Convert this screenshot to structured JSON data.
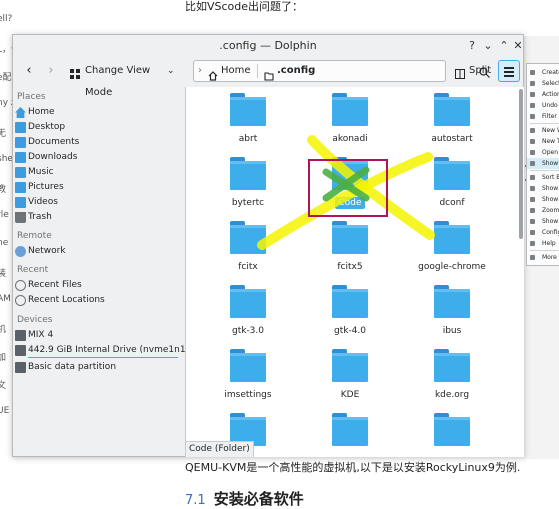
{
  "background": {
    "top_text": "比如VScode出问题了：",
    "left_fragments": [
      "ell?",
      "L，优",
      "e配",
      "ny z",
      "无",
      "she",
      "教",
      "rle",
      "ne",
      "装",
      "AM",
      "机",
      "加",
      "文",
      "UE"
    ],
    "bottom_text": "QEMU-KVM是一个高性能的虚拟机,以下是以安装RockyLinux9为例.",
    "heading_number": "7.1",
    "heading_text": "安装必备软件"
  },
  "window": {
    "title": ".config — Dolphin",
    "buttons": {
      "help": "?",
      "minimize": "⌄",
      "maximize": "⌃",
      "close": "✕"
    }
  },
  "toolbar": {
    "back": "‹",
    "forward": "›",
    "change_view_mode": "Change View Mode",
    "home_crumb": "Home",
    "current_crumb": ".config",
    "split": "Split"
  },
  "sidebar": {
    "places_header": "Places",
    "places": [
      "Home",
      "Desktop",
      "Documents",
      "Downloads",
      "Music",
      "Pictures",
      "Videos",
      "Trash"
    ],
    "remote_header": "Remote",
    "remote": [
      "Network"
    ],
    "recent_header": "Recent",
    "recent": [
      "Recent Files",
      "Recent Locations"
    ],
    "devices_header": "Devices",
    "devices": [
      "MIX 4",
      "442.9 GiB Internal Drive (nvme1n1p...",
      "Basic data partition"
    ]
  },
  "files": [
    "abrt",
    "akonadi",
    "autostart",
    "bytertc",
    "Code",
    "dconf",
    "fcitx",
    "fcitx5",
    "google-chrome",
    "gtk-3.0",
    "gtk-4.0",
    "ibus",
    "imsettings",
    "KDE",
    "kde.org",
    "",
    "",
    ""
  ],
  "selected_file": "Code",
  "status": "Code (Folder)",
  "popup_menu": [
    "Create",
    "Select",
    "Action",
    "Undo",
    "Filter",
    "New W",
    "New T",
    "Open",
    "Show",
    "Sort B",
    "Show",
    "Show",
    "Zoom",
    "Show",
    "Config",
    "Help",
    "More"
  ],
  "colors": {
    "accent": "#3daee9",
    "folder": "#3daee9",
    "markup_yellow": "#f5f500",
    "markup_magenta": "#b0125e",
    "markup_green": "#4bb043"
  }
}
